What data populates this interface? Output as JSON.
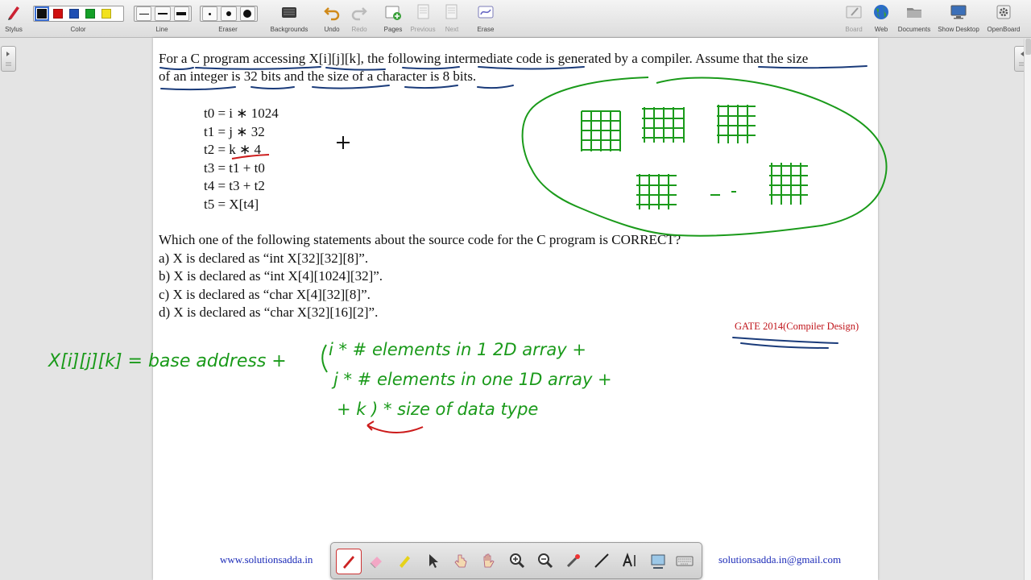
{
  "toolbar": {
    "stylus_label": "Stylus",
    "color_label": "Color",
    "line_label": "Line",
    "eraser_label": "Eraser",
    "backgrounds_label": "Backgrounds",
    "undo_label": "Undo",
    "redo_label": "Redo",
    "pages_label": "Pages",
    "previous_label": "Previous",
    "next_label": "Next",
    "erase_label": "Erase",
    "board_label": "Board",
    "web_label": "Web",
    "documents_label": "Documents",
    "show_desktop_label": "Show Desktop",
    "openboard_label": "OpenBoard",
    "colors": [
      "#111111",
      "#d01010",
      "#1f4fb4",
      "#14a028",
      "#f2e21c"
    ]
  },
  "page": {
    "question_line1": "For a C program accessing X[i][j][k], the following intermediate code is generated by a compiler. Assume that the size",
    "question_line2": "of an integer is 32 bits and the size of a character is 8 bits.",
    "code": [
      "t0 = i ∗ 1024",
      "t1 = j ∗ 32",
      "t2 = k ∗ 4",
      "t3 = t1 + t0",
      "t4 = t3 + t2",
      "t5 = X[t4]"
    ],
    "mcq_prompt": "Which one of the following statements about the source code for the C program is CORRECT?",
    "options": [
      "a) X is declared as “int X[32][32][8]”.",
      "b) X is declared as “int X[4][1024][32]”.",
      "c) X is declared as “char X[4][32][8]”.",
      "d) X is declared as “char X[32][16][2]”."
    ],
    "source": "GATE 2014(Compiler Design)",
    "footer_site": "www.solutionsadda.in",
    "footer_email": "solutionsadda.in@gmail.com"
  },
  "annotations": {
    "formula_lhs": "X[i][j][k] = base address +",
    "term1": "i * # elements in 1 2D array +",
    "term2": "j * # elements in one 1D array +",
    "term3": "+ k ) * size of data type",
    "ink_green": "#1a9a1a",
    "ink_red": "#cc1b1b",
    "ink_blue": "#1a3b7a"
  },
  "dock": {
    "tools": [
      "pen-tool",
      "eraser-tool",
      "marker-tool",
      "selector-tool",
      "interact-tool",
      "hand-tool",
      "zoom-in-tool",
      "zoom-out-tool",
      "laser-pointer-tool",
      "line-tool",
      "text-tool",
      "capture-tool",
      "keyboard-tool"
    ],
    "selected": "pen-tool"
  }
}
